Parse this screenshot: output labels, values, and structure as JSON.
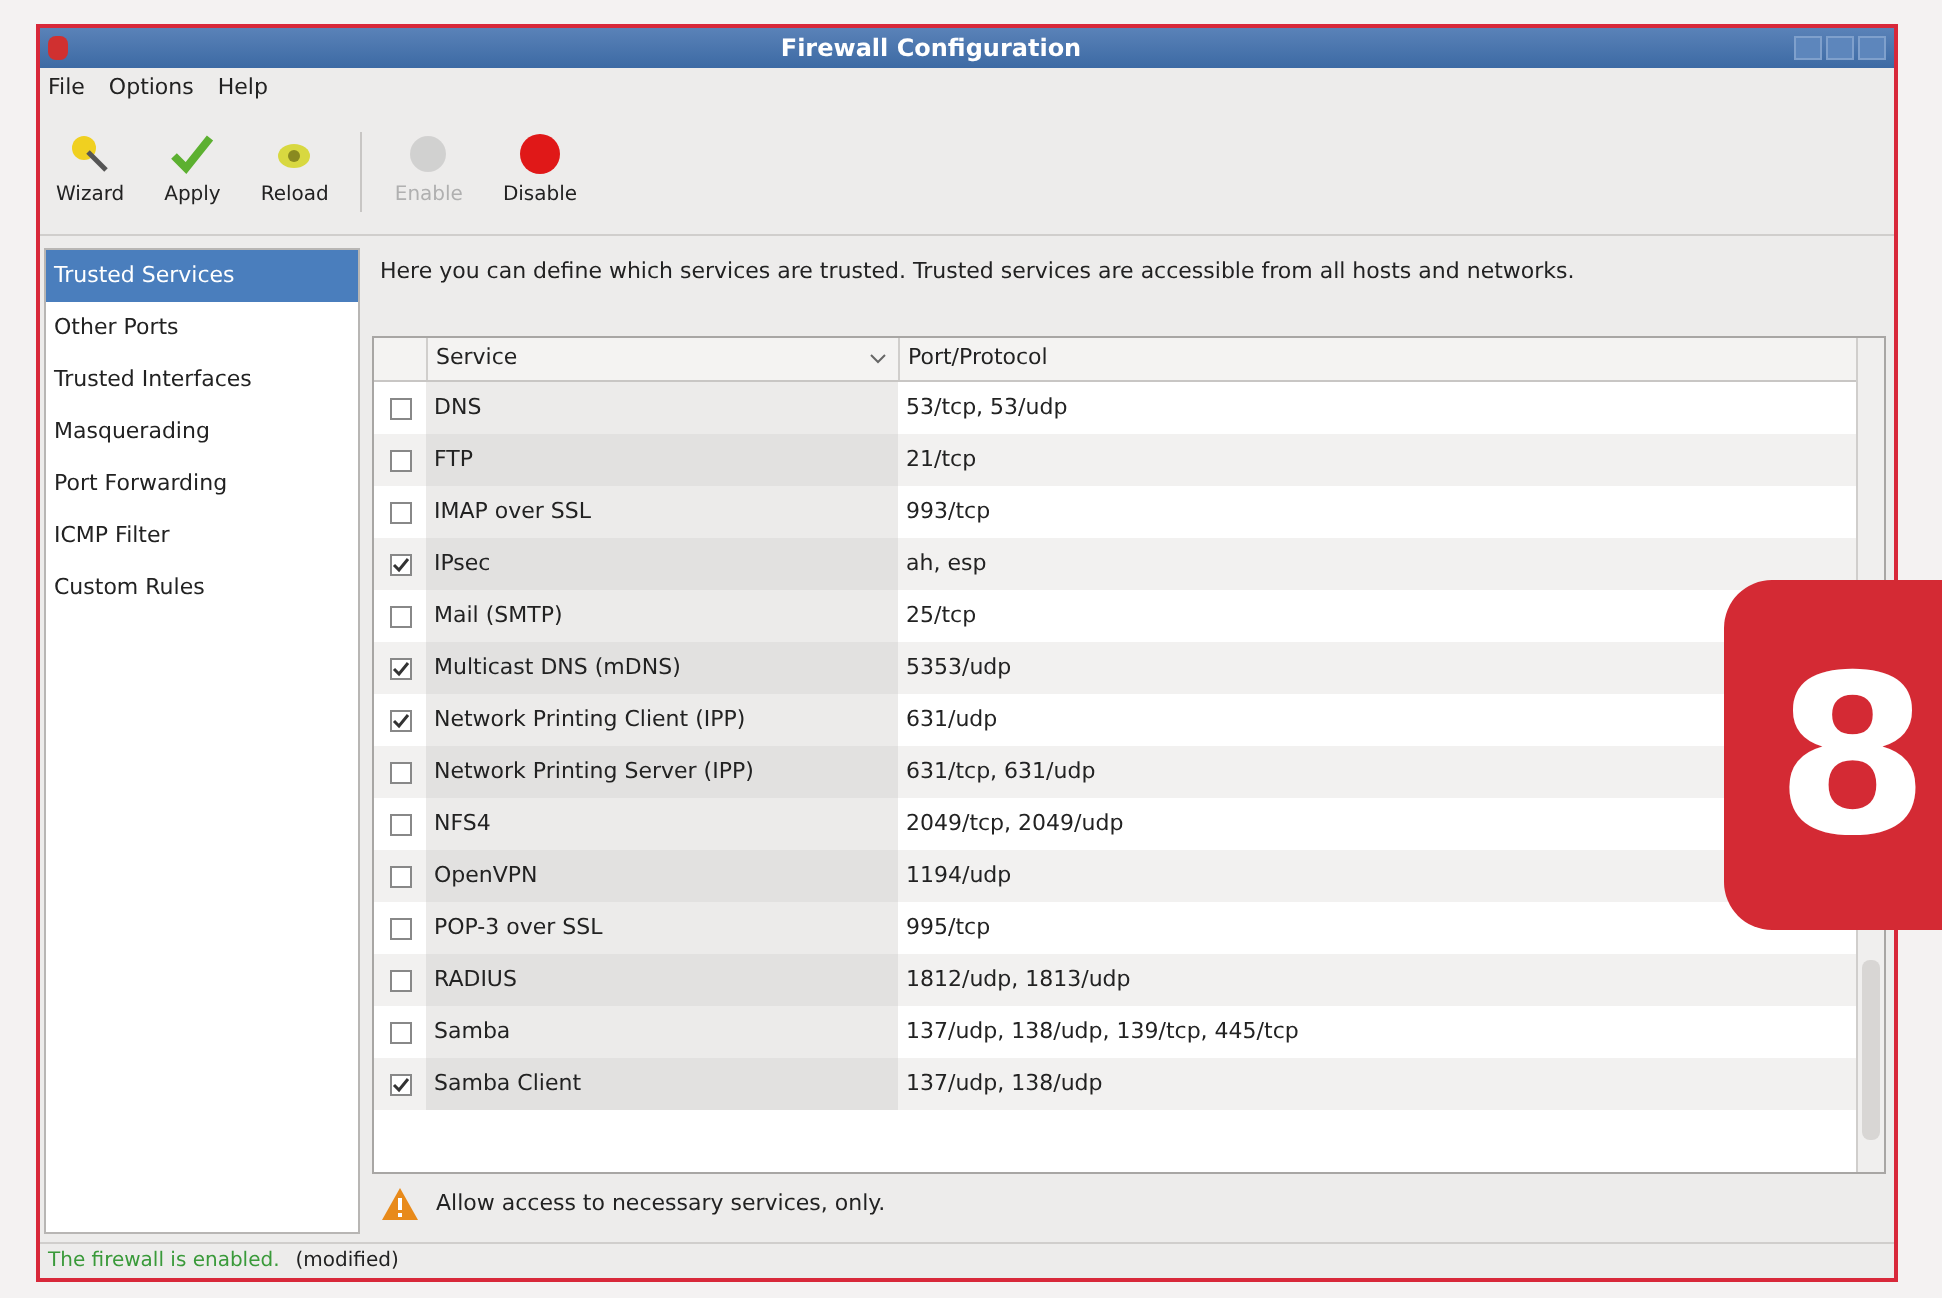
{
  "window": {
    "title": "Firewall Configuration"
  },
  "menu": [
    "File",
    "Options",
    "Help"
  ],
  "toolbar": [
    {
      "label": "Wizard",
      "kind": "wizard",
      "disabled": false
    },
    {
      "label": "Apply",
      "kind": "apply",
      "disabled": false
    },
    {
      "label": "Reload",
      "kind": "reload",
      "disabled": false
    },
    {
      "label": "Enable",
      "kind": "enable",
      "disabled": true
    },
    {
      "label": "Disable",
      "kind": "disable",
      "disabled": false
    }
  ],
  "sidebar": {
    "items": [
      {
        "label": "Trusted Services",
        "selected": true
      },
      {
        "label": "Other Ports",
        "selected": false
      },
      {
        "label": "Trusted Interfaces",
        "selected": false
      },
      {
        "label": "Masquerading",
        "selected": false
      },
      {
        "label": "Port Forwarding",
        "selected": false
      },
      {
        "label": "ICMP Filter",
        "selected": false
      },
      {
        "label": "Custom Rules",
        "selected": false
      }
    ]
  },
  "description": "Here you can define which services are trusted. Trusted services are accessible from all hosts and networks.",
  "table": {
    "columns": [
      "Service",
      "Port/Protocol"
    ],
    "rows": [
      {
        "service": "DNS",
        "port": "53/tcp, 53/udp",
        "checked": false
      },
      {
        "service": "FTP",
        "port": "21/tcp",
        "checked": false
      },
      {
        "service": "IMAP over SSL",
        "port": "993/tcp",
        "checked": false
      },
      {
        "service": "IPsec",
        "port": "ah, esp",
        "checked": true
      },
      {
        "service": "Mail (SMTP)",
        "port": "25/tcp",
        "checked": false
      },
      {
        "service": "Multicast DNS (mDNS)",
        "port": "5353/udp",
        "checked": true
      },
      {
        "service": "Network Printing Client (IPP)",
        "port": "631/udp",
        "checked": true
      },
      {
        "service": "Network Printing Server (IPP)",
        "port": "631/tcp, 631/udp",
        "checked": false
      },
      {
        "service": "NFS4",
        "port": "2049/tcp, 2049/udp",
        "checked": false
      },
      {
        "service": "OpenVPN",
        "port": "1194/udp",
        "checked": false
      },
      {
        "service": "POP-3 over SSL",
        "port": "995/tcp",
        "checked": false
      },
      {
        "service": "RADIUS",
        "port": "1812/udp, 1813/udp",
        "checked": false
      },
      {
        "service": "Samba",
        "port": "137/udp, 138/udp, 139/tcp, 445/tcp",
        "checked": false
      },
      {
        "service": "Samba Client",
        "port": "137/udp, 138/udp",
        "checked": true
      }
    ]
  },
  "warning": "Allow access to necessary services, only.",
  "status_bar": {
    "state": "The firewall is enabled.",
    "note": "(modified)"
  },
  "step_badge": "8"
}
